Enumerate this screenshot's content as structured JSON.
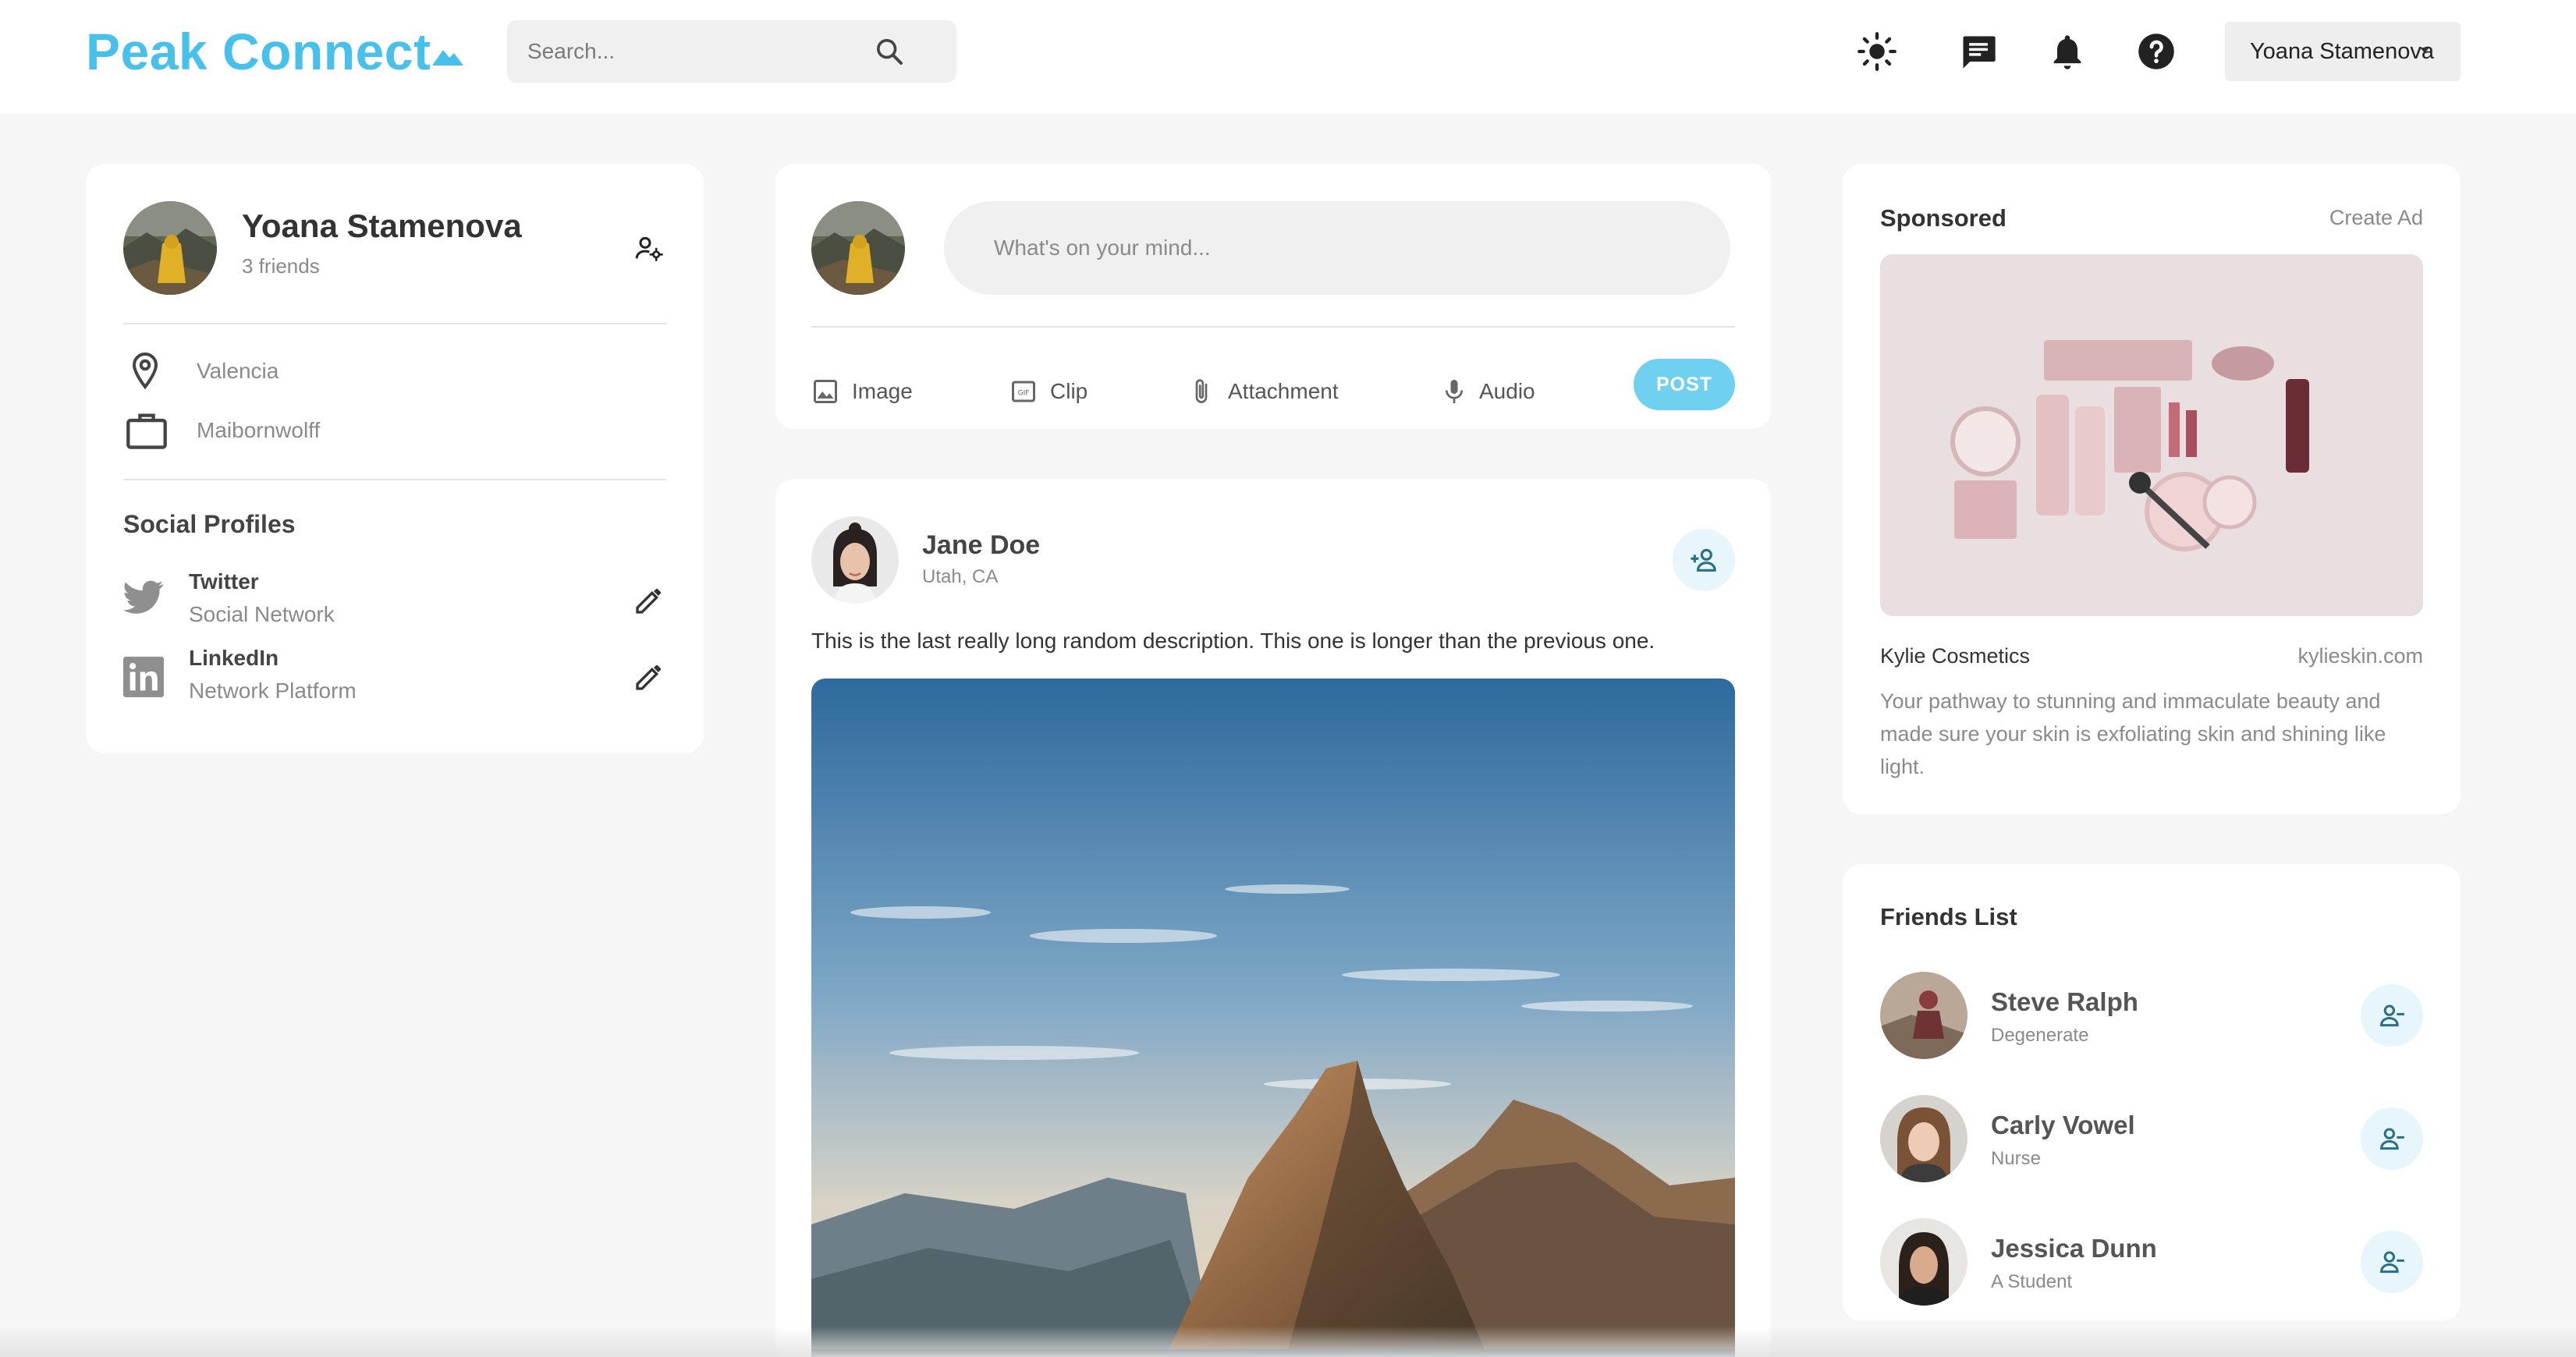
{
  "navbar": {
    "logo": "Peak Connect",
    "search_placeholder": "Search...",
    "user_name": "Yoana Stamenova",
    "icons": [
      "sun-icon",
      "message-icon",
      "bell-icon",
      "help-icon"
    ]
  },
  "profile": {
    "name": "Yoana Stamenova",
    "friends": "3 friends",
    "location": "Valencia",
    "occupation": "Maibornwolff",
    "social_title": "Social Profiles",
    "socials": [
      {
        "name": "Twitter",
        "type": "Social Network"
      },
      {
        "name": "LinkedIn",
        "type": "Network Platform"
      }
    ]
  },
  "composer": {
    "placeholder": "What's on your mind...",
    "actions": [
      "Image",
      "Clip",
      "Attachment",
      "Audio"
    ],
    "post_label": "POST"
  },
  "post": {
    "author": "Jane Doe",
    "location": "Utah, CA",
    "description": "This is the last really long random description. This one is longer than the previous one."
  },
  "sponsored": {
    "title": "Sponsored",
    "create_ad": "Create Ad",
    "brand": "Kylie Cosmetics",
    "site": "kylieskin.com",
    "description": "Your pathway to stunning and immaculate beauty and made sure your skin is exfoliating skin and shining like light."
  },
  "friends_list": {
    "title": "Friends List",
    "friends": [
      {
        "name": "Steve Ralph",
        "occupation": "Degenerate"
      },
      {
        "name": "Carly Vowel",
        "occupation": "Nurse"
      },
      {
        "name": "Jessica Dunn",
        "occupation": "A Student"
      }
    ]
  },
  "colors": {
    "brand": "#47c0ec",
    "post_button": "#6fd0ef",
    "background": "#f6f6f6",
    "card": "#ffffff"
  }
}
